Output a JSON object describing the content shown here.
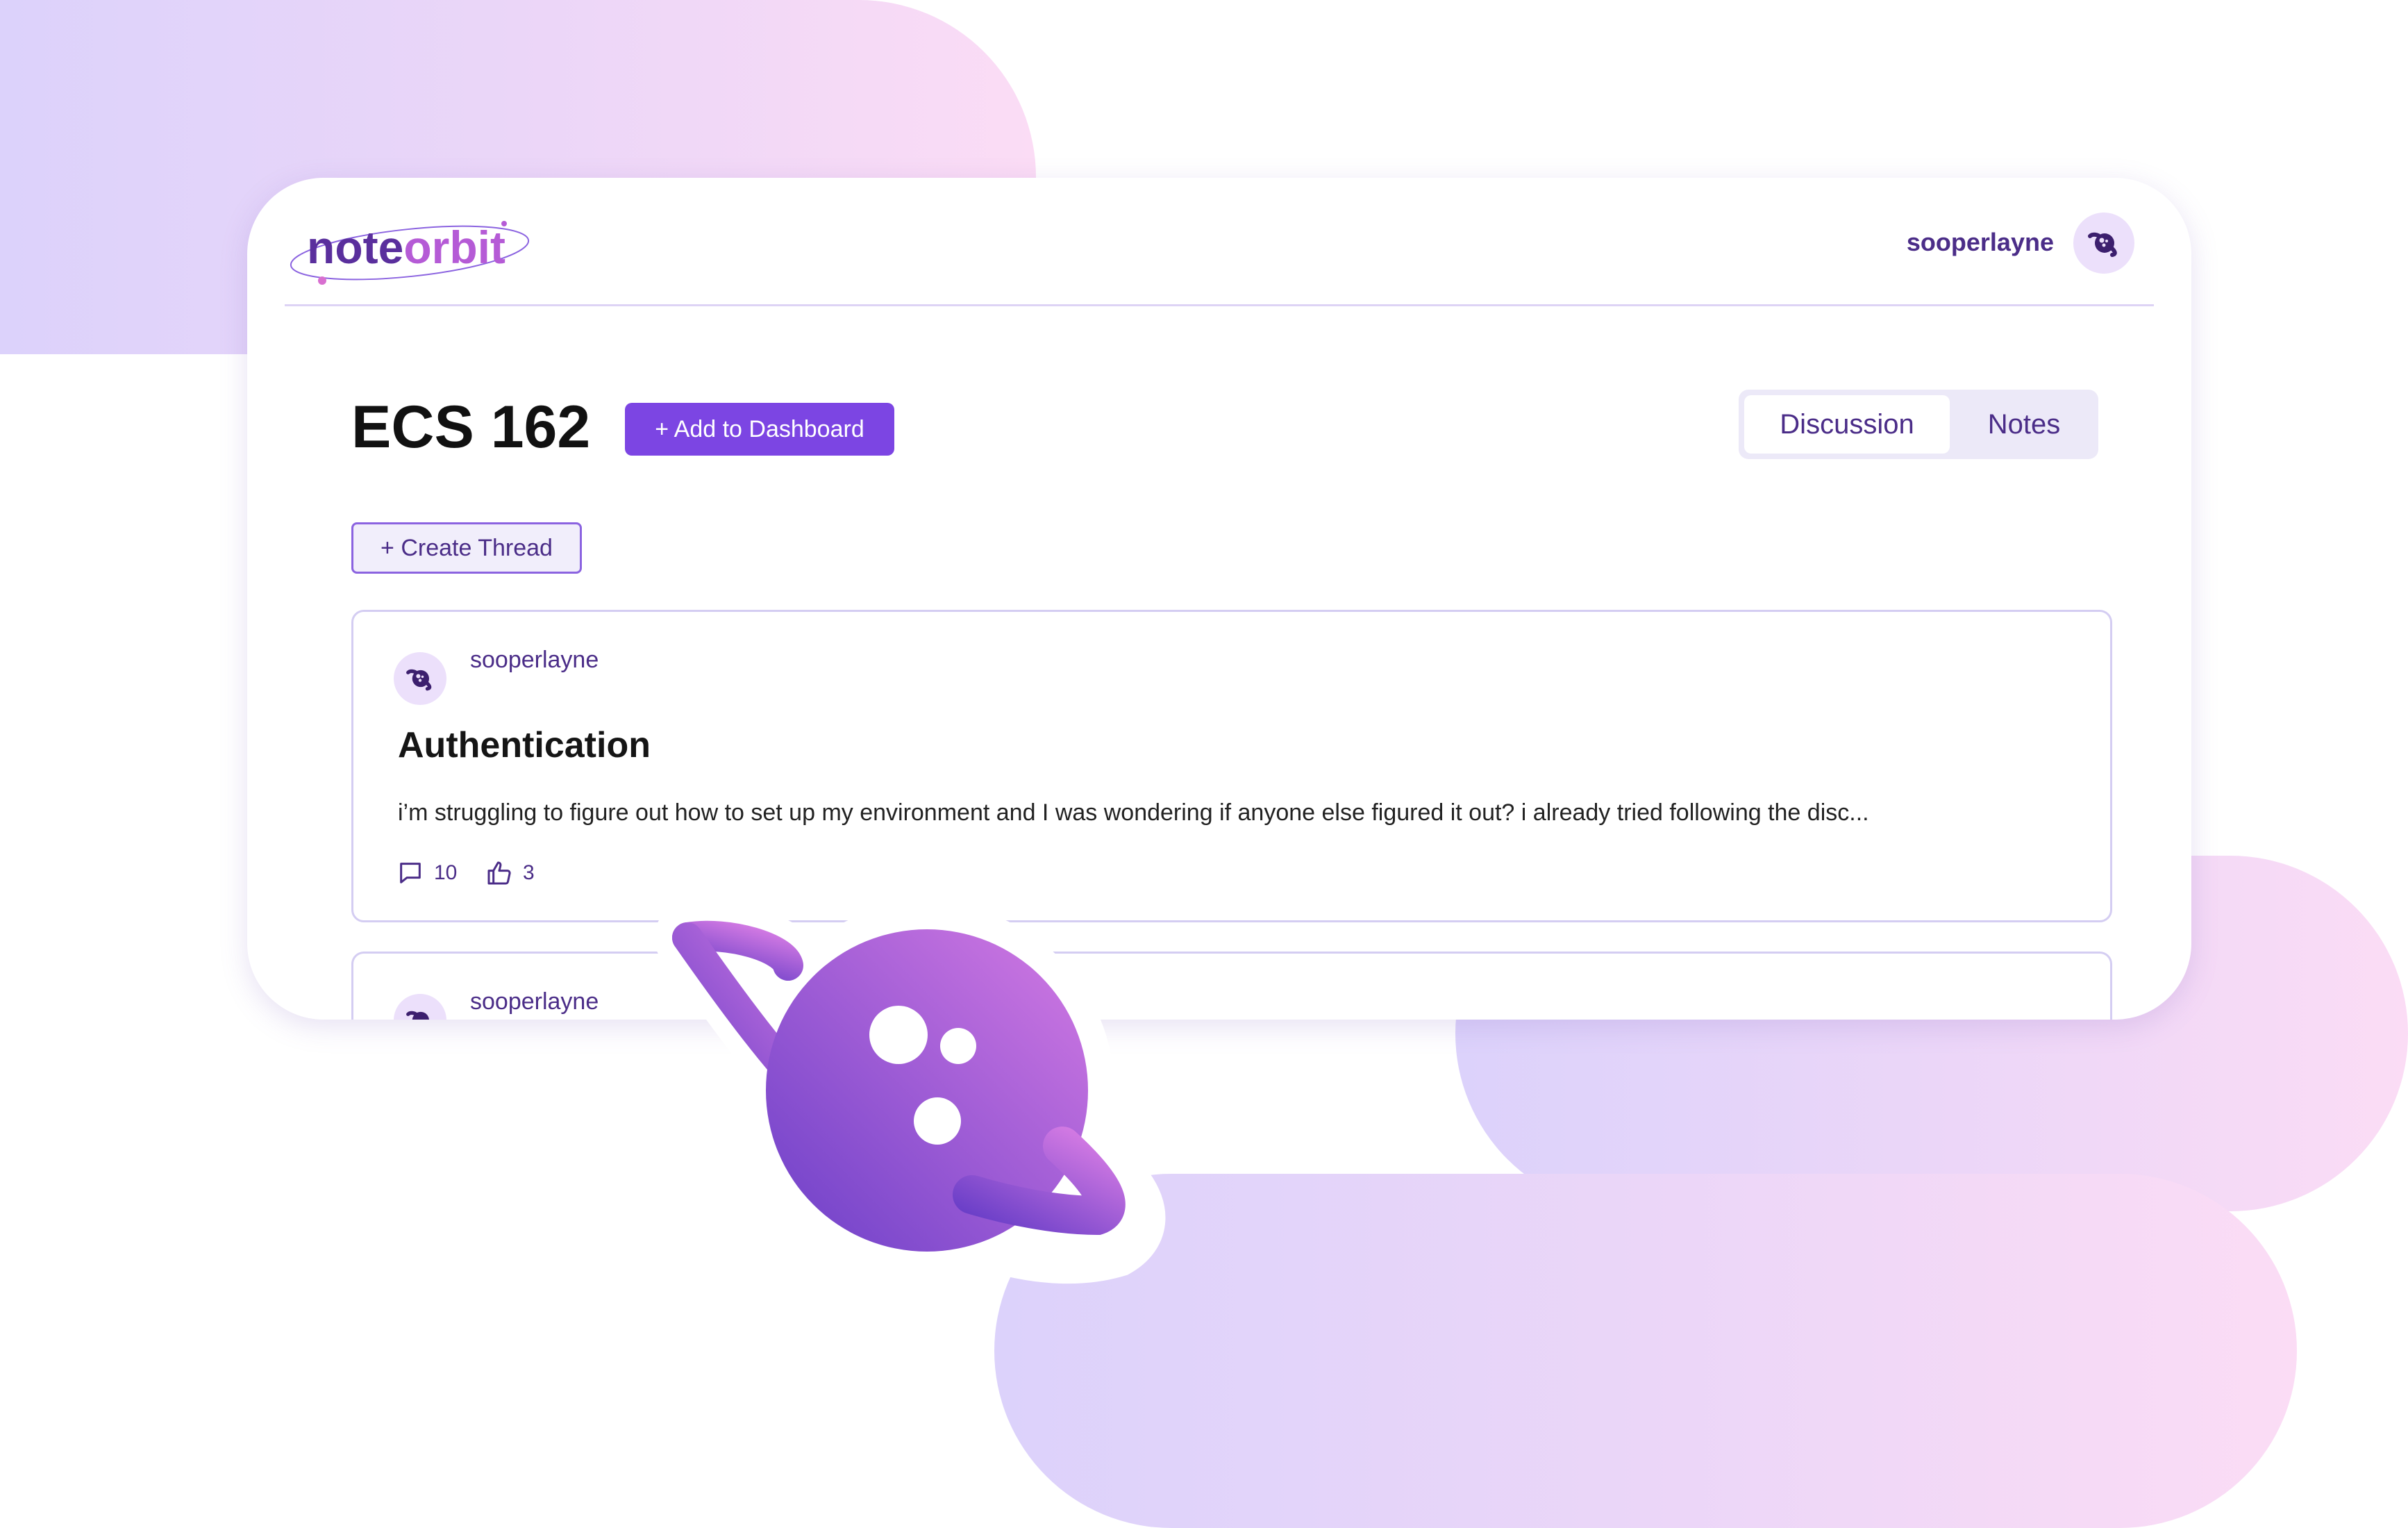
{
  "brand": {
    "logo_prefix": "note",
    "logo_suffix": "orbit"
  },
  "header": {
    "username": "sooperlayne"
  },
  "course": {
    "title": "ECS 162",
    "add_button": "+ Add to Dashboard"
  },
  "tabs": [
    {
      "label": "Discussion",
      "active": true
    },
    {
      "label": "Notes",
      "active": false
    }
  ],
  "create_thread_button": "+ Create Thread",
  "threads": [
    {
      "author": "sooperlayne",
      "title": "Authentication",
      "body": "i’m struggling to figure out how to set up my environment and I was wondering if anyone else figured it out? i already tried following the disc...",
      "comments": "10",
      "likes": "3"
    },
    {
      "author": "sooperlayne"
    }
  ],
  "icons": {
    "avatar": "planet-avatar-icon",
    "comment": "comment-icon",
    "like": "thumbs-up-icon",
    "decor": "planet-mascot-icon"
  },
  "colors": {
    "primary": "#7c45e3",
    "text_purple": "#4b2d88",
    "logo_accent": "#b55bd6"
  }
}
